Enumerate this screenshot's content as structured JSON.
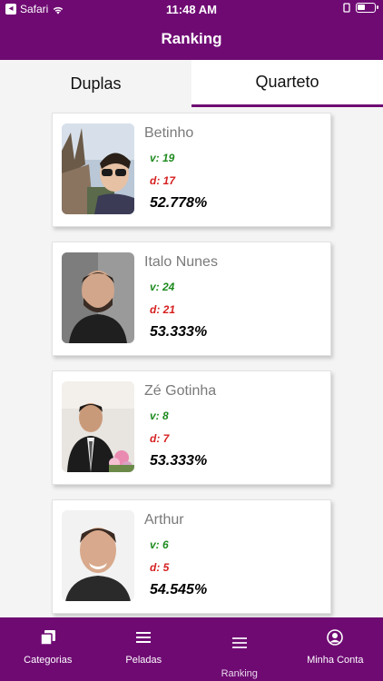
{
  "status": {
    "carrier": "Safari",
    "time": "11:48 AM"
  },
  "header": {
    "title": "Ranking"
  },
  "tabs": [
    {
      "label": "Duplas",
      "active": false
    },
    {
      "label": "Quarteto",
      "active": true
    }
  ],
  "players": [
    {
      "name": "Betinho",
      "wins": "v: 19",
      "losses": "d: 17",
      "percent": "52.778%"
    },
    {
      "name": "Italo Nunes",
      "wins": "v: 24",
      "losses": "d: 21",
      "percent": "53.333%"
    },
    {
      "name": "Zé Gotinha",
      "wins": "v: 8",
      "losses": "d: 7",
      "percent": "53.333%"
    },
    {
      "name": "Arthur",
      "wins": "v: 6",
      "losses": "d: 5",
      "percent": "54.545%"
    }
  ],
  "bottom_nav": [
    {
      "label": "Categorias",
      "icon": "cards-icon"
    },
    {
      "label": "Peladas",
      "icon": "list-icon"
    },
    {
      "label": "Ranking",
      "icon": "list-icon",
      "active": true
    },
    {
      "label": "Minha Conta",
      "icon": "user-circle-icon"
    }
  ],
  "colors": {
    "primary": "#6f0a73",
    "wins": "#1d8a1d",
    "losses": "#d62020"
  }
}
